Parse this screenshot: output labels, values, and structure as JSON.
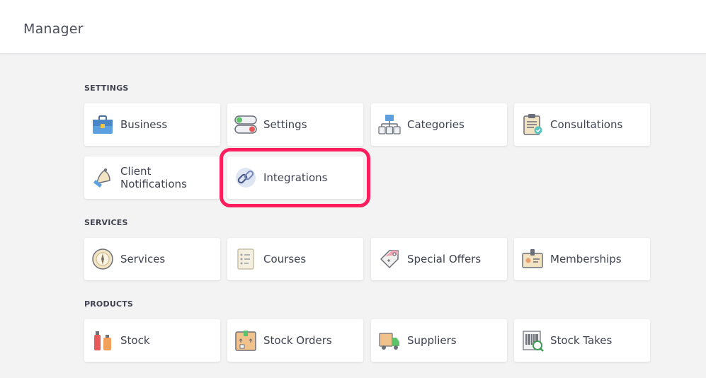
{
  "header": {
    "title": "Manager"
  },
  "sections": {
    "settings": {
      "label": "SETTINGS",
      "items": [
        {
          "label": "Business",
          "icon": "briefcase-icon"
        },
        {
          "label": "Settings",
          "icon": "toggles-icon"
        },
        {
          "label": "Categories",
          "icon": "hierarchy-icon"
        },
        {
          "label": "Consultations",
          "icon": "clipboard-icon"
        },
        {
          "label": "Client Notifications",
          "icon": "bell-icon"
        },
        {
          "label": "Integrations",
          "icon": "link-icon"
        }
      ]
    },
    "services": {
      "label": "SERVICES",
      "items": [
        {
          "label": "Services",
          "icon": "compass-icon"
        },
        {
          "label": "Courses",
          "icon": "checklist-icon"
        },
        {
          "label": "Special Offers",
          "icon": "price-tag-icon"
        },
        {
          "label": "Memberships",
          "icon": "id-badge-icon"
        }
      ]
    },
    "products": {
      "label": "PRODUCTS",
      "items": [
        {
          "label": "Stock",
          "icon": "bottles-icon"
        },
        {
          "label": "Stock Orders",
          "icon": "parcel-icon"
        },
        {
          "label": "Suppliers",
          "icon": "delivery-truck-icon"
        },
        {
          "label": "Stock Takes",
          "icon": "barcode-scan-icon"
        }
      ]
    }
  },
  "colors": {
    "highlight": "#ff1d5e",
    "background": "#f3f3f4"
  }
}
